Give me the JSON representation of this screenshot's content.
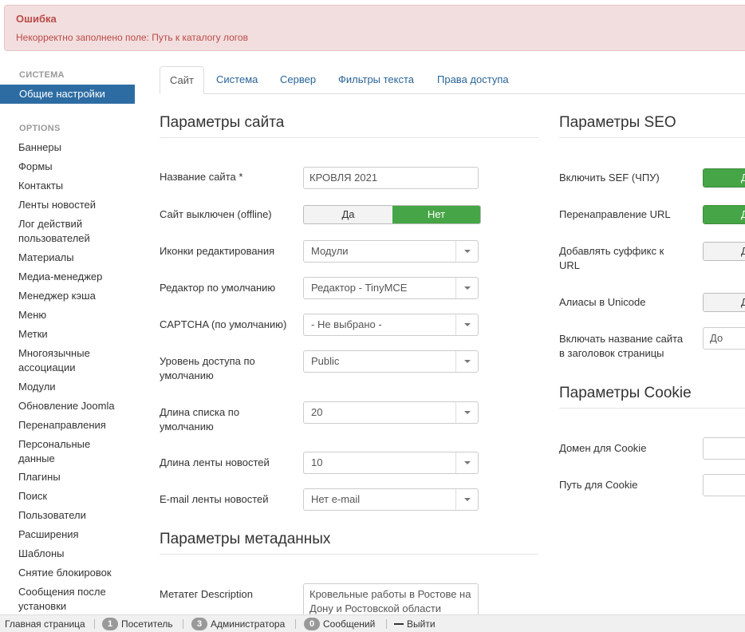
{
  "alert": {
    "title": "Ошибка",
    "message": "Некорректно заполнено поле: Путь к каталогу логов"
  },
  "sidebar": {
    "system_heading": "СИСТЕМА",
    "active_item": "Общие настройки",
    "options_heading": "OPTIONS",
    "items": [
      "Баннеры",
      "Формы",
      "Контакты",
      "Ленты новостей",
      "Лог действий пользователей",
      "Материалы",
      "Медиа-менеджер",
      "Менеджер кэша",
      "Меню",
      "Метки",
      "Многоязычные ассоциации",
      "Модули",
      "Обновление Joomla",
      "Перенаправления",
      "Персональные данные",
      "Плагины",
      "Поиск",
      "Пользователи",
      "Расширения",
      "Шаблоны",
      "Снятие блокировок",
      "Сообщения после установки"
    ]
  },
  "tabs": [
    "Сайт",
    "Система",
    "Сервер",
    "Фильтры текста",
    "Права доступа"
  ],
  "site": {
    "title": "Параметры сайта",
    "site_name_label": "Название сайта *",
    "site_name_value": "КРОВЛЯ 2021",
    "offline_label": "Сайт выключен (offline)",
    "offline_yes": "Да",
    "offline_no": "Нет",
    "edit_icons_label": "Иконки редактирования",
    "edit_icons_value": "Модули",
    "editor_label": "Редактор по умолчанию",
    "editor_value": "Редактор - TinyMCE",
    "captcha_label": "CAPTCHA (по умолчанию)",
    "captcha_value": "- Не выбрано -",
    "access_label": "Уровень доступа по умолчанию",
    "access_value": "Public",
    "list_length_label": "Длина списка по умолчанию",
    "list_length_value": "20",
    "feed_length_label": "Длина ленты новостей",
    "feed_length_value": "10",
    "feed_email_label": "E-mail ленты новостей",
    "feed_email_value": "Нет e-mail"
  },
  "meta": {
    "title": "Параметры метаданных",
    "description_label": "Метатег Description",
    "description_value": "Кровельные работы в Ростове на Дону и Ростовской области"
  },
  "seo": {
    "title": "Параметры SEO",
    "sef_label": "Включить SEF (ЧПУ)",
    "sef_value": "Да",
    "rewrite_label": "Перенаправление URL",
    "rewrite_value": "Да",
    "suffix_label": "Добавлять суффикс к URL",
    "suffix_value": "Да",
    "unicode_label": "Алиасы в Unicode",
    "unicode_value": "Да",
    "sitename_label": "Включать название сайта в заголовок страницы",
    "sitename_value": "До"
  },
  "cookie": {
    "title": "Параметры Cookie",
    "domain_label": "Домен для Cookie",
    "path_label": "Путь для Cookie"
  },
  "statusbar": {
    "home": "Главная страница",
    "visitors_count": "1",
    "visitors_label": "Посетитель",
    "admins_count": "3",
    "admins_label": "Администратора",
    "messages_count": "0",
    "messages_label": "Сообщений",
    "logout": "Выйти"
  },
  "colors": {
    "accent": "#2d6ca2",
    "toggle_on": "#46a546",
    "alert_bg": "#f2dede",
    "alert_text": "#b94a48"
  }
}
